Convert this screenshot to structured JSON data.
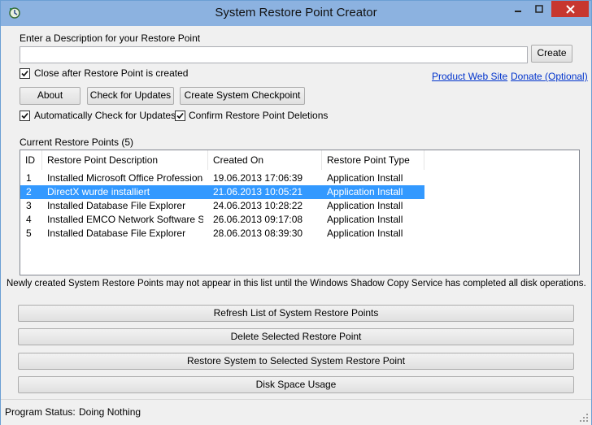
{
  "window": {
    "title": "System Restore Point Creator"
  },
  "form": {
    "description_label": "Enter a Description for your Restore Point",
    "description_value": "",
    "create_label": "Create",
    "close_after_label": "Close after Restore Point is created",
    "close_after_checked": true,
    "product_link": "Product Web Site",
    "donate_link": "Donate (Optional)",
    "about_label": "About",
    "check_updates_label": "Check for Updates",
    "checkpoint_label": "Create System Checkpoint",
    "auto_check_label": "Automatically Check for Updates",
    "auto_check_checked": true,
    "confirm_delete_label": "Confirm Restore Point Deletions",
    "confirm_delete_checked": true
  },
  "list": {
    "title": "Current Restore Points (5)",
    "columns": [
      "ID",
      "Restore Point Description",
      "Created On",
      "Restore Point Type"
    ],
    "rows": [
      [
        "1",
        "Installed Microsoft Office Professional ...",
        "19.06.2013 17:06:39",
        "Application Install"
      ],
      [
        "2",
        "DirectX wurde installiert",
        "21.06.2013 10:05:21",
        "Application Install"
      ],
      [
        "3",
        "Installed Database File Explorer",
        "24.06.2013 10:28:22",
        "Application Install"
      ],
      [
        "4",
        "Installed EMCO Network Software Sca...",
        "26.06.2013 09:17:08",
        "Application Install"
      ],
      [
        "5",
        "Installed Database File Explorer",
        "28.06.2013 08:39:30",
        "Application Install"
      ]
    ],
    "selected_row": 2,
    "note": "Newly created System Restore Points may not appear in this list until the Windows Shadow Copy Service has completed all disk operations."
  },
  "actions": {
    "refresh": "Refresh List of System Restore Points",
    "delete": "Delete Selected Restore Point",
    "restore": "Restore System to Selected System Restore Point",
    "disk_usage": "Disk Space Usage"
  },
  "status": {
    "label": "Program Status:",
    "value": "Doing Nothing"
  },
  "colors": {
    "title_bar": "#8cb2e0",
    "close_button": "#c7372f",
    "selection": "#3399ff",
    "link": "#0033cc"
  }
}
